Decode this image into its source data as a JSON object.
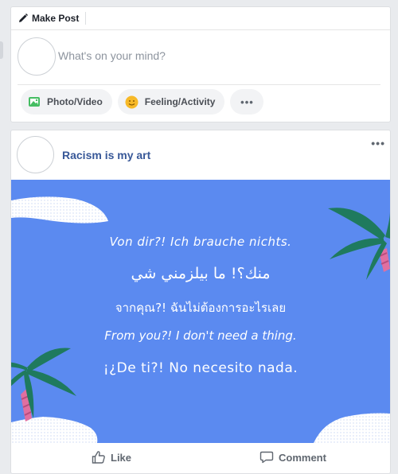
{
  "composer": {
    "title": "Make Post",
    "placeholder": "What's on your mind?",
    "actions": [
      {
        "label": "Photo/Video",
        "icon": "photo-icon"
      },
      {
        "label": "Feeling/Activity",
        "icon": "smiley-icon"
      },
      {
        "label": "•••",
        "icon": "more-icon"
      }
    ]
  },
  "post": {
    "author": "Racism is my art",
    "more": "•••",
    "image_text": [
      "Von dir?! Ich brauche nichts.",
      "منك؟! ما بيلزمني شي",
      "จากคุณ?! ฉันไม่ต้องการอะไรเลย",
      "From you?! I don't need a thing.",
      "¡¿De ti?! No necesito nada."
    ],
    "actions": {
      "like": "Like",
      "comment": "Comment"
    }
  },
  "colors": {
    "page_bg": "#e9ebee",
    "image_bg": "#5b8af0",
    "link": "#385898",
    "palm": "#1f7a5e"
  }
}
